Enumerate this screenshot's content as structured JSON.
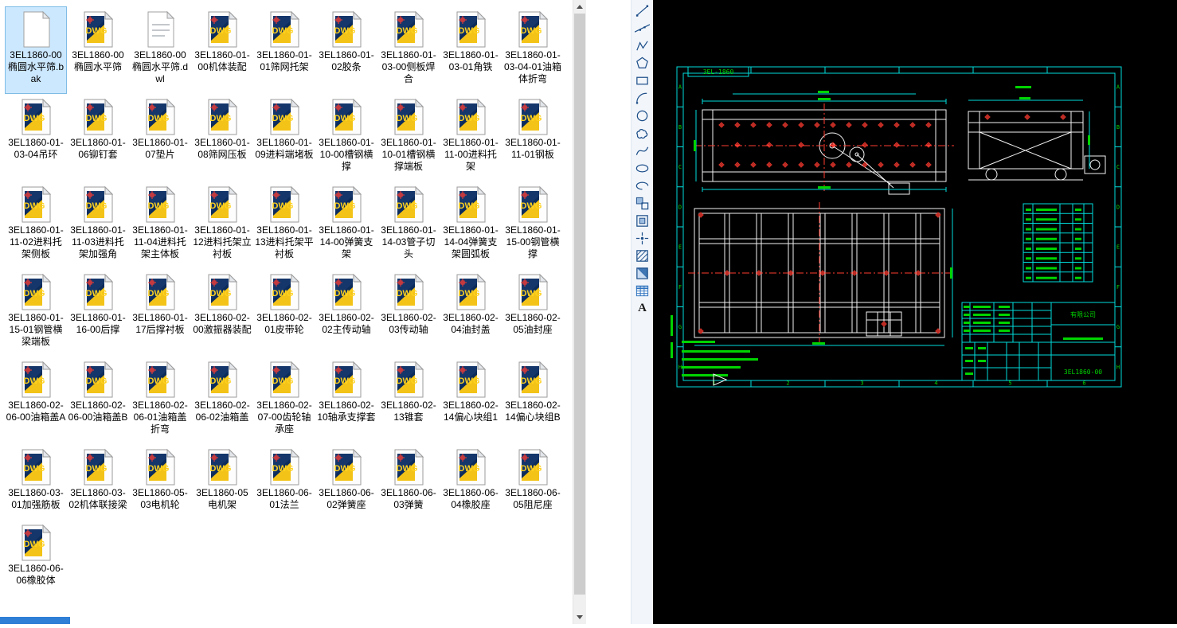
{
  "colors": {
    "accent_selection": "#cce8ff",
    "cad_cyan": "#00dcdc",
    "cad_green": "#00d400",
    "cad_red": "#ff3b30",
    "cad_white": "#f2f2f2",
    "dwg_blue": "#14366b",
    "dwg_yellow": "#f3c318"
  },
  "file_panel": {
    "selected_index": 0,
    "icon_label": "DWG",
    "files": [
      {
        "name": "3EL1860-00椭圆水平筛.bak",
        "type": "bak"
      },
      {
        "name": "3EL1860-00椭圆水平筛",
        "type": "dwg"
      },
      {
        "name": "3EL1860-00椭圆水平筛.dwl",
        "type": "dwl"
      },
      {
        "name": "3EL1860-01-00机体装配",
        "type": "dwg"
      },
      {
        "name": "3EL1860-01-01筛网托架",
        "type": "dwg"
      },
      {
        "name": "3EL1860-01-02胶条",
        "type": "dwg"
      },
      {
        "name": "3EL1860-01-03-00侧板焊合",
        "type": "dwg"
      },
      {
        "name": "3EL1860-01-03-01角铁",
        "type": "dwg"
      },
      {
        "name": "3EL1860-01-03-04-01油箱体折弯",
        "type": "dwg"
      },
      {
        "name": "3EL1860-01-03-04吊环",
        "type": "dwg"
      },
      {
        "name": "3EL1860-01-06铆钉套",
        "type": "dwg"
      },
      {
        "name": "3EL1860-01-07垫片",
        "type": "dwg"
      },
      {
        "name": "3EL1860-01-08筛网压板",
        "type": "dwg"
      },
      {
        "name": "3EL1860-01-09进料端堵板",
        "type": "dwg"
      },
      {
        "name": "3EL1860-01-10-00槽钢横撑",
        "type": "dwg"
      },
      {
        "name": "3EL1860-01-10-01槽钢横撑端板",
        "type": "dwg"
      },
      {
        "name": "3EL1860-01-11-00进料托架",
        "type": "dwg"
      },
      {
        "name": "3EL1860-01-11-01钢板",
        "type": "dwg"
      },
      {
        "name": "3EL1860-01-11-02进料托架侧板",
        "type": "dwg"
      },
      {
        "name": "3EL1860-01-11-03进料托架加强角",
        "type": "dwg"
      },
      {
        "name": "3EL1860-01-11-04进料托架主体板",
        "type": "dwg"
      },
      {
        "name": "3EL1860-01-12进料托架立衬板",
        "type": "dwg"
      },
      {
        "name": "3EL1860-01-13进料托架平衬板",
        "type": "dwg"
      },
      {
        "name": "3EL1860-01-14-00弹簧支架",
        "type": "dwg"
      },
      {
        "name": "3EL1860-01-14-03管子切头",
        "type": "dwg"
      },
      {
        "name": "3EL1860-01-14-04弹簧支架圆弧板",
        "type": "dwg"
      },
      {
        "name": "3EL1860-01-15-00钢管横撑",
        "type": "dwg"
      },
      {
        "name": "3EL1860-01-15-01钢管横梁端板",
        "type": "dwg"
      },
      {
        "name": "3EL1860-01-16-00后撑",
        "type": "dwg"
      },
      {
        "name": "3EL1860-01-17后撑衬板",
        "type": "dwg"
      },
      {
        "name": "3EL1860-02-00激振器装配",
        "type": "dwg"
      },
      {
        "name": "3EL1860-02-01皮带轮",
        "type": "dwg"
      },
      {
        "name": "3EL1860-02-02主传动轴",
        "type": "dwg"
      },
      {
        "name": "3EL1860-02-03传动轴",
        "type": "dwg"
      },
      {
        "name": "3EL1860-02-04油封盖",
        "type": "dwg"
      },
      {
        "name": "3EL1860-02-05油封座",
        "type": "dwg"
      },
      {
        "name": "3EL1860-02-06-00油箱盖A",
        "type": "dwg"
      },
      {
        "name": "3EL1860-02-06-00油箱盖B",
        "type": "dwg"
      },
      {
        "name": "3EL1860-02-06-01油箱盖折弯",
        "type": "dwg"
      },
      {
        "name": "3EL1860-02-06-02油箱盖",
        "type": "dwg"
      },
      {
        "name": "3EL1860-02-07-00齿轮轴承座",
        "type": "dwg"
      },
      {
        "name": "3EL1860-02-10轴承支撑套",
        "type": "dwg"
      },
      {
        "name": "3EL1860-02-13锥套",
        "type": "dwg"
      },
      {
        "name": "3EL1860-02-14偏心块组1",
        "type": "dwg"
      },
      {
        "name": "3EL1860-02-14偏心块组B",
        "type": "dwg"
      },
      {
        "name": "3EL1860-03-01加强筋板",
        "type": "dwg"
      },
      {
        "name": "3EL1860-03-02机体联接梁",
        "type": "dwg"
      },
      {
        "name": "3EL1860-05-03电机轮",
        "type": "dwg"
      },
      {
        "name": "3EL1860-05电机架",
        "type": "dwg"
      },
      {
        "name": "3EL1860-06-01法兰",
        "type": "dwg"
      },
      {
        "name": "3EL1860-06-02弹簧座",
        "type": "dwg"
      },
      {
        "name": "3EL1860-06-03弹簧",
        "type": "dwg"
      },
      {
        "name": "3EL1860-06-04橡胶座",
        "type": "dwg"
      },
      {
        "name": "3EL1860-06-05阻尼座",
        "type": "dwg"
      },
      {
        "name": "3EL1860-06-06橡胶体",
        "type": "dwg"
      }
    ]
  },
  "toolbar": {
    "mtext_label": "A",
    "items": [
      "line",
      "construction-line",
      "polyline",
      "polygon",
      "rectangle",
      "arc",
      "circle",
      "revision-cloud",
      "spline",
      "ellipse",
      "ellipse-arc",
      "insert-block",
      "make-block",
      "point",
      "hatch",
      "gradient",
      "table",
      "multiline-text"
    ]
  },
  "cad": {
    "drawing_label": "3EL-1860",
    "zone_numbers": [
      "1",
      "2",
      "3",
      "4",
      "5",
      "6"
    ],
    "zone_letters": [
      "A",
      "B",
      "C",
      "D",
      "E",
      "F",
      "G",
      "H"
    ],
    "title_block": {
      "company": "有限公司",
      "drawing_no": "3EL1860-00"
    }
  }
}
